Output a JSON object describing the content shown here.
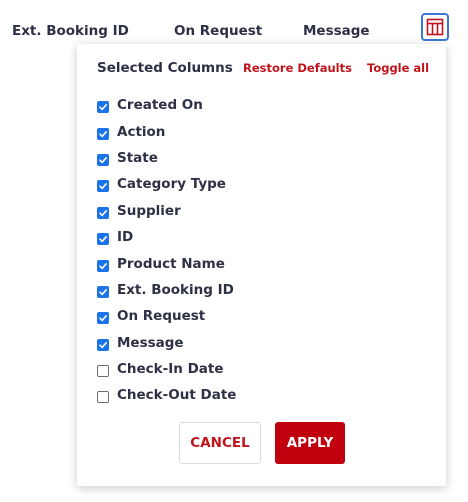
{
  "header": {
    "columns": [
      "Ext. Booking ID",
      "On Request",
      "Message"
    ],
    "column_toggle_icon": "table-columns-icon"
  },
  "panel": {
    "title": "Selected Columns",
    "restore_label": "Restore Defaults",
    "toggle_all_label": "Toggle all",
    "items": [
      {
        "label": "Created On",
        "checked": true
      },
      {
        "label": "Action",
        "checked": true
      },
      {
        "label": "State",
        "checked": true
      },
      {
        "label": "Category Type",
        "checked": true
      },
      {
        "label": "Supplier",
        "checked": true
      },
      {
        "label": "ID",
        "checked": true
      },
      {
        "label": "Product Name",
        "checked": true
      },
      {
        "label": "Ext. Booking ID",
        "checked": true
      },
      {
        "label": "On Request",
        "checked": true
      },
      {
        "label": "Message",
        "checked": true
      },
      {
        "label": "Check-In Date",
        "checked": false
      },
      {
        "label": "Check-Out Date",
        "checked": false
      }
    ],
    "cancel_label": "CANCEL",
    "apply_label": "APPLY"
  },
  "colors": {
    "accent_red": "#c0000c",
    "link_red": "#c0141c",
    "checkbox_blue": "#1a73e8",
    "toggle_border_blue": "#3a78d8",
    "text_dark": "#2e3145"
  }
}
